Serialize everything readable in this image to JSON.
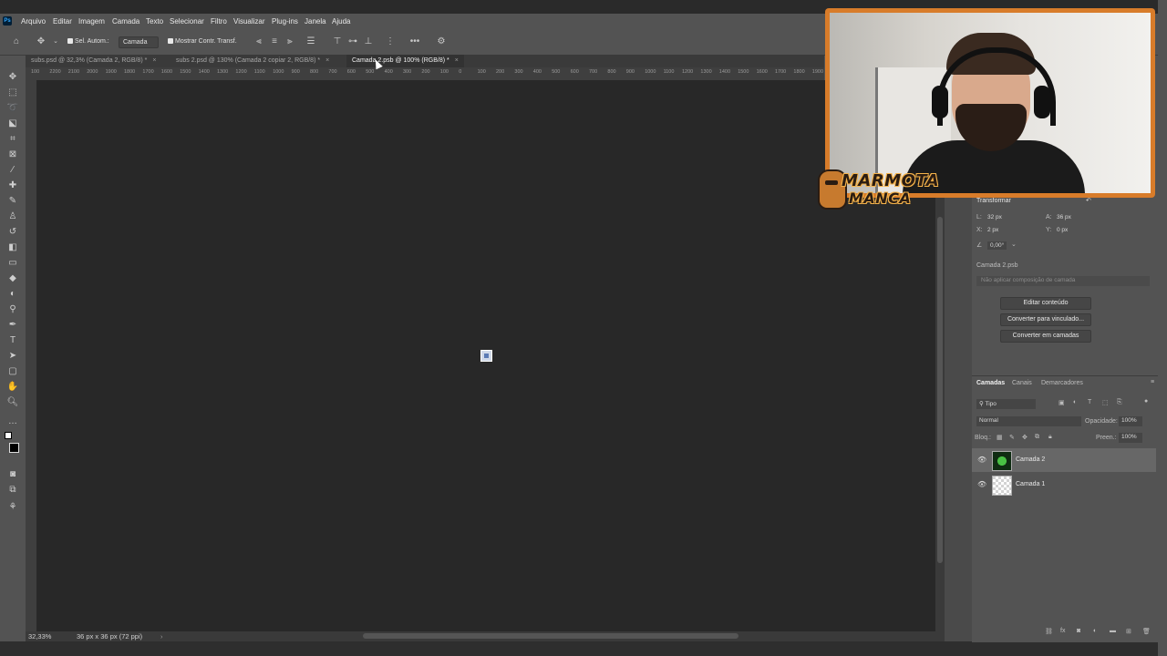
{
  "menubar": {
    "items": [
      "Arquivo",
      "Editar",
      "Imagem",
      "Camada",
      "Texto",
      "Selecionar",
      "Filtro",
      "Visualizar",
      "Plug-ins",
      "Janela",
      "Ajuda"
    ]
  },
  "options": {
    "auto_select_label": "Sel. Autom.:",
    "auto_select_target": "Camada",
    "show_transform_label": "Mostrar Contr. Transf."
  },
  "tabs": [
    {
      "label": "subs.psd @ 32,3% (Camada 2, RGB/8) *",
      "active": false
    },
    {
      "label": "subs 2.psd @ 130% (Camada 2 copiar 2, RGB/8) *",
      "active": false
    },
    {
      "label": "Camada 2.psb @ 100% (RGB/8) *",
      "active": true
    }
  ],
  "ruler": {
    "h_labels": [
      "100",
      "2200",
      "2100",
      "2000",
      "1900",
      "1800",
      "1700",
      "1600",
      "1500",
      "1400",
      "1300",
      "1200",
      "1100",
      "1000",
      "900",
      "800",
      "700",
      "600",
      "500",
      "400",
      "300",
      "200",
      "100",
      "0",
      "100",
      "200",
      "300",
      "400",
      "500",
      "600",
      "700",
      "800",
      "900",
      "1000",
      "1100",
      "1200",
      "1300",
      "1400",
      "1500",
      "1600",
      "1700",
      "1800",
      "1900"
    ]
  },
  "status": {
    "zoom": "32,33%",
    "doc_info": "36 px x 36 px (72 ppi)"
  },
  "properties": {
    "section_title": "Transformar",
    "w_label": "L:",
    "w_value": "32 px",
    "h_label": "A:",
    "h_value": "36 px",
    "x_label": "X:",
    "x_value": "2 px",
    "y_label": "Y:",
    "y_value": "0 px",
    "angle_value": "0,00°",
    "smart_object_name": "Camada 2.psb",
    "composition_placeholder": "Não aplicar composição de camada",
    "buttons": [
      "Editar conteúdo",
      "Converter para vinculado...",
      "Converter em camadas"
    ]
  },
  "layers": {
    "tabs": [
      "Camadas",
      "Canais",
      "Demarcadores"
    ],
    "filter_label": "Tipo",
    "blend_mode": "Normal",
    "opacity_label": "Opacidade:",
    "opacity_value": "100%",
    "lock_label": "Bloq.:",
    "fill_label": "Preen.:",
    "fill_value": "100%",
    "items": [
      {
        "name": "Camada 2",
        "selected": true
      },
      {
        "name": "Camada 1",
        "selected": false
      }
    ]
  },
  "overlay": {
    "brand_line1": "MARMOTA",
    "brand_line2": "MANCA"
  }
}
